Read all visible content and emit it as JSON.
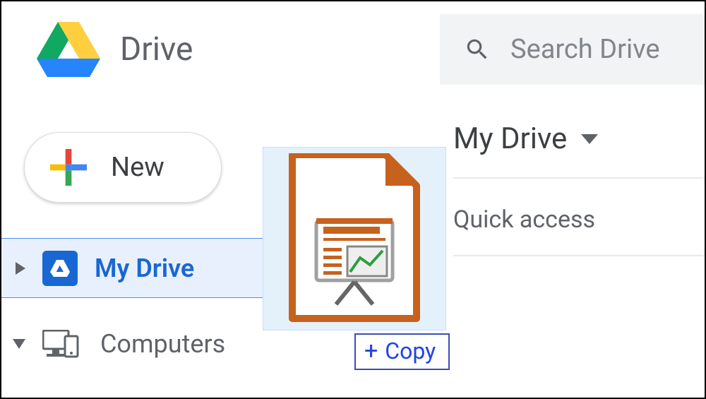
{
  "header": {
    "product_name": "Drive",
    "search_placeholder": "Search Drive"
  },
  "sidebar": {
    "new_label": "New",
    "items": [
      {
        "label": "My Drive"
      },
      {
        "label": "Computers"
      }
    ]
  },
  "main": {
    "breadcrumb": "My Drive",
    "quick_access_label": "Quick access"
  },
  "drag": {
    "action_label": "Copy"
  }
}
